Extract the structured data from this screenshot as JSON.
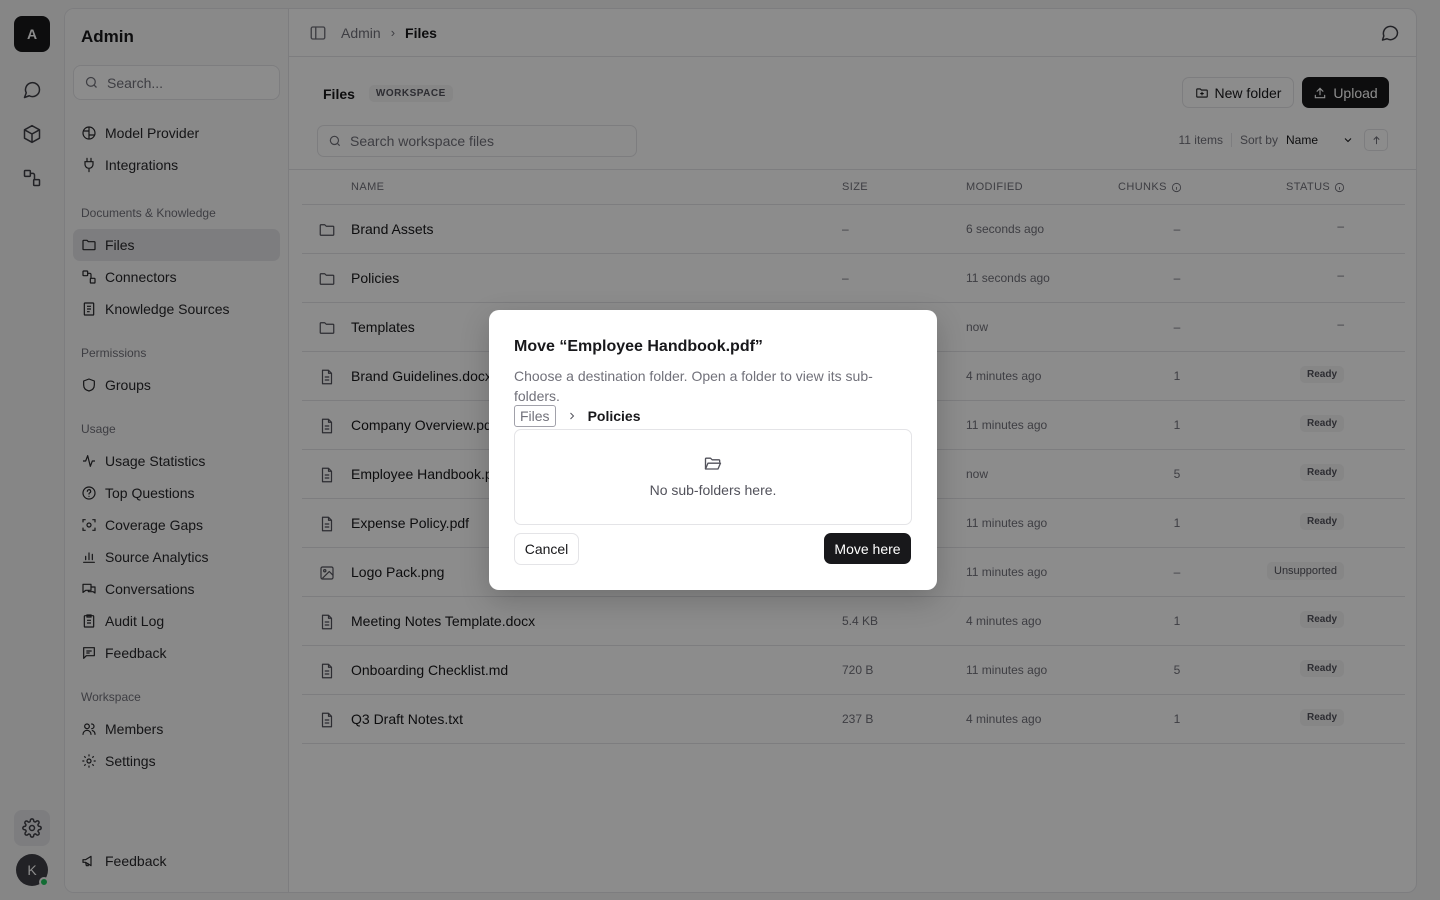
{
  "rail": {
    "logo_letter": "A",
    "avatar_letter": "K"
  },
  "sidebar": {
    "title": "Admin",
    "search_placeholder": "Search...",
    "top_items": [
      {
        "label": "Model Provider",
        "icon": "brain-icon"
      },
      {
        "label": "Integrations",
        "icon": "plug-icon"
      }
    ],
    "sections": [
      {
        "heading": "Documents & Knowledge",
        "items": [
          {
            "label": "Files",
            "icon": "folder-icon",
            "active": true
          },
          {
            "label": "Connectors",
            "icon": "connector-icon"
          },
          {
            "label": "Knowledge Sources",
            "icon": "book-icon"
          }
        ]
      },
      {
        "heading": "Permissions",
        "items": [
          {
            "label": "Groups",
            "icon": "shield-icon"
          }
        ]
      },
      {
        "heading": "Usage",
        "items": [
          {
            "label": "Usage Statistics",
            "icon": "activity-icon"
          },
          {
            "label": "Top Questions",
            "icon": "help-circle-icon"
          },
          {
            "label": "Coverage Gaps",
            "icon": "scan-icon"
          },
          {
            "label": "Source Analytics",
            "icon": "bar-chart-icon"
          },
          {
            "label": "Conversations",
            "icon": "messages-icon"
          },
          {
            "label": "Audit Log",
            "icon": "clipboard-icon"
          },
          {
            "label": "Feedback",
            "icon": "message-square-icon"
          }
        ]
      },
      {
        "heading": "Workspace",
        "items": [
          {
            "label": "Members",
            "icon": "users-icon"
          },
          {
            "label": "Settings",
            "icon": "gear-icon"
          }
        ]
      }
    ],
    "bottom_item": {
      "label": "Feedback",
      "icon": "megaphone-icon"
    }
  },
  "topbar": {
    "crumb_root": "Admin",
    "crumb_current": "Files"
  },
  "files": {
    "title": "Files",
    "badge": "WORKSPACE",
    "new_folder_label": "New folder",
    "upload_label": "Upload",
    "search_placeholder": "Search workspace files",
    "item_count": "11 items",
    "sort_by_label": "Sort by",
    "sort_value": "Name",
    "columns": {
      "name": "NAME",
      "size": "SIZE",
      "modified": "MODIFIED",
      "chunks": "CHUNKS",
      "status": "STATUS"
    },
    "rows": [
      {
        "type": "folder",
        "name": "Brand Assets",
        "size": "–",
        "modified": "6 seconds ago",
        "chunks": "–",
        "status": "–"
      },
      {
        "type": "folder",
        "name": "Policies",
        "size": "–",
        "modified": "11 seconds ago",
        "chunks": "–",
        "status": "–"
      },
      {
        "type": "folder",
        "name": "Templates",
        "size": "",
        "modified": "now",
        "chunks": "–",
        "status": "–"
      },
      {
        "type": "file",
        "name": "Brand Guidelines.docx",
        "size": "",
        "modified": "4 minutes ago",
        "chunks": "1",
        "status": "Ready"
      },
      {
        "type": "file",
        "name": "Company Overview.pdf",
        "size": "",
        "modified": "11 minutes ago",
        "chunks": "1",
        "status": "Ready"
      },
      {
        "type": "file",
        "name": "Employee Handbook.pdf",
        "size": "",
        "modified": "now",
        "chunks": "5",
        "status": "Ready"
      },
      {
        "type": "file",
        "name": "Expense Policy.pdf",
        "size": "",
        "modified": "11 minutes ago",
        "chunks": "1",
        "status": "Ready"
      },
      {
        "type": "image",
        "name": "Logo Pack.png",
        "size": "",
        "modified": "11 minutes ago",
        "chunks": "–",
        "status": "Unsupported"
      },
      {
        "type": "file",
        "name": "Meeting Notes Template.docx",
        "size": "5.4 KB",
        "modified": "4 minutes ago",
        "chunks": "1",
        "status": "Ready"
      },
      {
        "type": "file",
        "name": "Onboarding Checklist.md",
        "size": "720 B",
        "modified": "11 minutes ago",
        "chunks": "5",
        "status": "Ready"
      },
      {
        "type": "file",
        "name": "Q3 Draft Notes.txt",
        "size": "237 B",
        "modified": "4 minutes ago",
        "chunks": "1",
        "status": "Ready"
      }
    ]
  },
  "dialog": {
    "title": "Move “Employee Handbook.pdf”",
    "description": "Choose a destination folder. Open a folder to view its sub-folders.",
    "crumb_root": "Files",
    "crumb_current": "Policies",
    "empty_message": "No sub-folders here.",
    "cancel_label": "Cancel",
    "confirm_label": "Move here"
  }
}
